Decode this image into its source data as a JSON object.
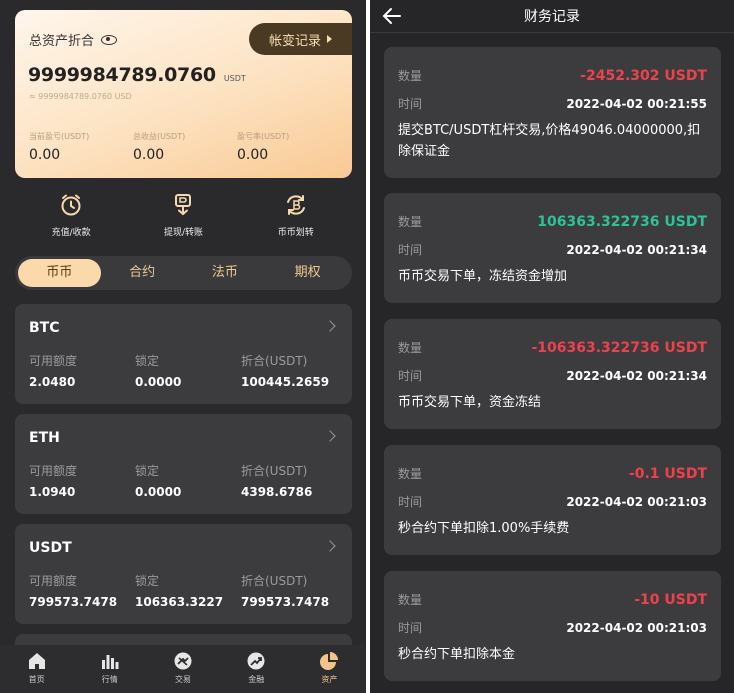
{
  "left": {
    "asset": {
      "title": "总资产折合",
      "record_button": "帐变记录",
      "amount": "9999984789.0760",
      "unit": "USDT",
      "approx": "≈ 9999984789.0760 USD",
      "stats": [
        {
          "label": "当前盈亏(USDT)",
          "value": "0.00"
        },
        {
          "label": "总收益(USDT)",
          "value": "0.00"
        },
        {
          "label": "盈亏率(USDT)",
          "value": "0.00"
        }
      ]
    },
    "actions": [
      {
        "label": "充值/收款",
        "icon": "deposit-clock-icon"
      },
      {
        "label": "提现/转账",
        "icon": "withdraw-bitcoin-icon"
      },
      {
        "label": "币币划转",
        "icon": "transfer-bitcoin-icon"
      }
    ],
    "tabs": [
      "币币",
      "合约",
      "法币",
      "期权"
    ],
    "coin_headers": {
      "available": "可用额度",
      "locked": "锁定",
      "converted": "折合(USDT)"
    },
    "coins": [
      {
        "name": "BTC",
        "available": "2.0480",
        "locked": "0.0000",
        "converted": "100445.2659"
      },
      {
        "name": "ETH",
        "available": "1.0940",
        "locked": "0.0000",
        "converted": "4398.6786"
      },
      {
        "name": "USDT",
        "available": "799573.7478",
        "locked": "106363.3227",
        "converted": "799573.7478"
      }
    ],
    "nav": [
      "首页",
      "行情",
      "交易",
      "金融",
      "资产"
    ]
  },
  "right": {
    "title": "财务记录",
    "qty_label": "数量",
    "time_label": "时间",
    "records": [
      {
        "amount": "-2452.302 USDT",
        "time": "2022-04-02 00:21:55",
        "desc": "提交BTC/USDT杠杆交易,价格49046.04000000,扣除保证金"
      },
      {
        "amount": "106363.322736 USDT",
        "time": "2022-04-02 00:21:34",
        "desc": "币币交易下单，冻结资金增加"
      },
      {
        "amount": "-106363.322736 USDT",
        "time": "2022-04-02 00:21:34",
        "desc": "币币交易下单，资金冻结"
      },
      {
        "amount": "-0.1 USDT",
        "time": "2022-04-02 00:21:03",
        "desc": "秒合约下单扣除1.00%手续费"
      },
      {
        "amount": "-10 USDT",
        "time": "2022-04-02 00:21:03",
        "desc": "秒合约下单扣除本金"
      }
    ]
  },
  "colors": {
    "negative": "#f0404e",
    "positive": "#2fc197",
    "accent": "#f3c48a"
  }
}
